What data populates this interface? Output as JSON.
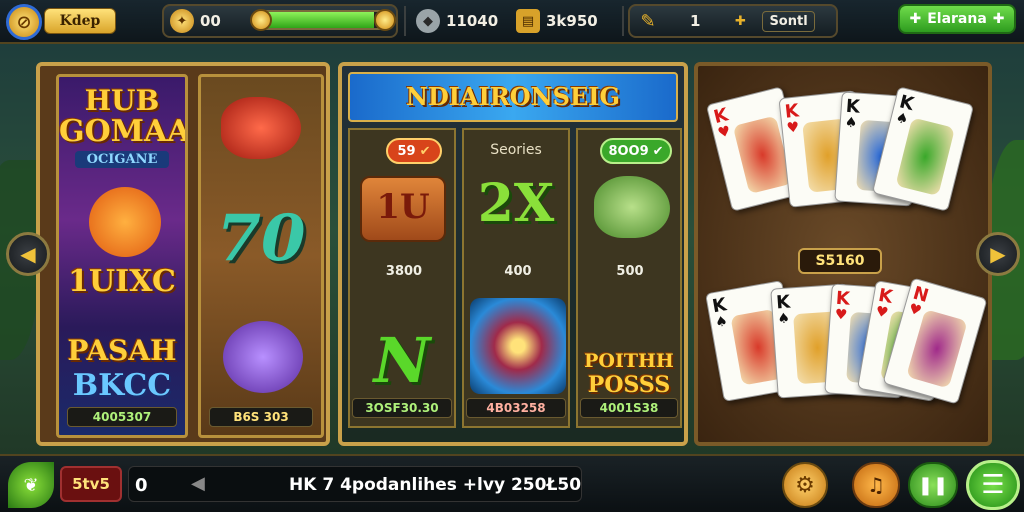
{
  "topbar": {
    "logo_glyph": "⊘",
    "logo_tag": "Kdep",
    "coins": {
      "icon": "paw-icon",
      "value": "00"
    },
    "xp_progress": 0.86,
    "gems": {
      "icon": "gem-icon",
      "value": "11040"
    },
    "chest": {
      "icon": "chest-icon",
      "value": "3k950"
    },
    "ticket": {
      "icon": "ticket-icon",
      "value": "1"
    },
    "plus_glyph": "✚",
    "shop_label": "Sontl",
    "exit_label": "Elarana",
    "exit_glyph": "✚"
  },
  "left_panel": {
    "strip1": {
      "title_line1": "HUB",
      "title_line2": "GOMAA",
      "subtitle": "OCIGANE",
      "middle": "1UIXC",
      "bottom_line1": "PASAH",
      "bottom_line2": "BKCC",
      "value": "4005307"
    },
    "strip2": {
      "middle": "70",
      "value": "B6S 303"
    }
  },
  "center_panel": {
    "title": "NDIAIRONSEIG",
    "col1": {
      "badge": "59",
      "badge_glyph": "✔",
      "top_text": "1U",
      "value": "3800",
      "bottom_text": "N",
      "footer": "3OSF30.30"
    },
    "col2": {
      "header": "Seories",
      "top_text": "2X",
      "value": "400",
      "footer": "4B03258"
    },
    "col3": {
      "badge": "8OO9",
      "badge_glyph": "✔",
      "value": "500",
      "bottom_line1": "POITHH",
      "bottom_line2": "POSSS",
      "footer": "4001S38"
    }
  },
  "right_panel": {
    "middle_badge": "S5160",
    "top_cards": [
      {
        "rank": "K",
        "suit": "♥"
      },
      {
        "rank": "K",
        "suit": "♥"
      },
      {
        "rank": "K",
        "suit": "♠"
      },
      {
        "rank": "K",
        "suit": "♠"
      }
    ],
    "bottom_cards": [
      {
        "rank": "K",
        "suit": "♠"
      },
      {
        "rank": "K",
        "suit": "♠"
      },
      {
        "rank": "K",
        "suit": "♥"
      },
      {
        "rank": "K",
        "suit": "♥"
      },
      {
        "rank": "N",
        "suit": "♥"
      }
    ]
  },
  "nav": {
    "left_arrow": "◀",
    "right_arrow": "▶"
  },
  "bottombar": {
    "bet_label": "5tv5",
    "bet_value": "0",
    "ticker": "HK 7  4podanlihes  +lvy 250Ł50",
    "settings_glyph": "⚙",
    "info_glyph": "♫",
    "pause_glyph": "❚❚",
    "menu_glyph": "☰"
  },
  "colors": {
    "gold": "#c9a14a",
    "green": "#3aa82a",
    "accent": "#ffcf3a"
  }
}
